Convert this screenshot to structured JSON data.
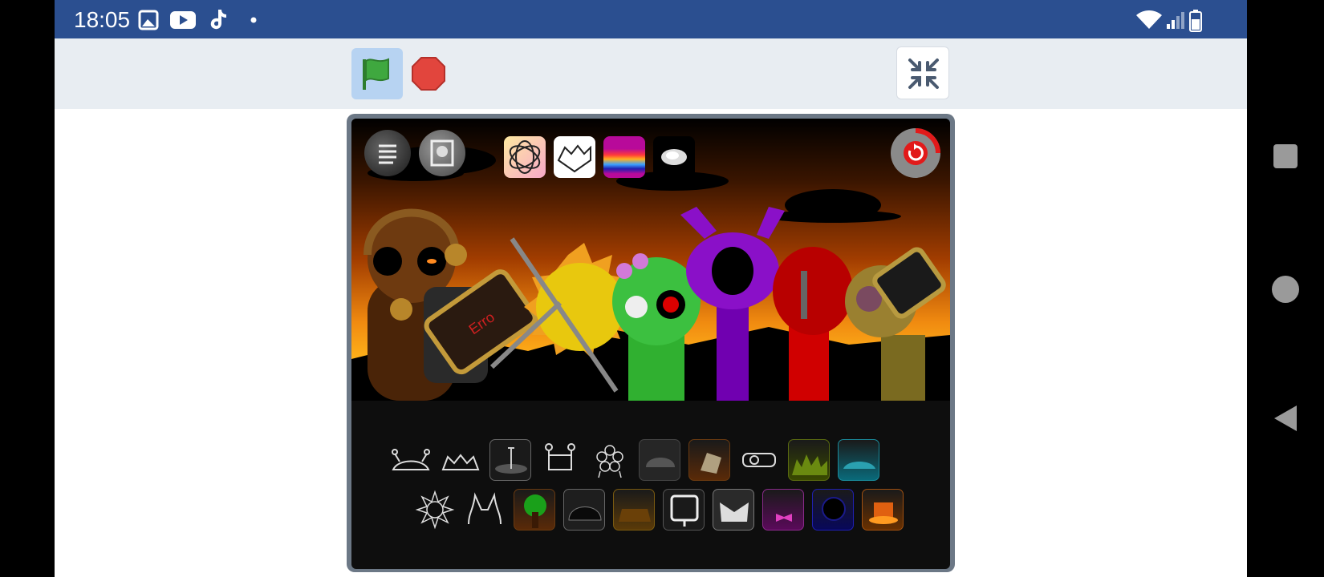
{
  "status": {
    "time": "18:05"
  },
  "colors": {
    "statusbar": "#2b4f90",
    "toolbar": "#e8edf2",
    "flag_green": "#3fa83f",
    "stop_red": "#e2453d"
  },
  "toolbar": {
    "flag_icon": "green-flag-icon",
    "stop_icon": "stop-sign-icon",
    "fullscreen_icon": "exit-fullscreen-icon"
  },
  "stage": {
    "monitor_text": "Erro",
    "top_buttons": [
      "menu",
      "mode-toggle",
      "theme-star",
      "theme-outline",
      "theme-rainbow",
      "theme-orb"
    ],
    "row1_slots": [
      "antenna-crab",
      "horns",
      "pole-dish",
      "robot-head",
      "flower-bunch",
      "dark-helmet",
      "brown-cap",
      "goggles",
      "green-grass",
      "teal-hat"
    ],
    "row2_slots": [
      "spiky-ball",
      "cat-ears",
      "green-tree",
      "dark-blob",
      "orange-hat",
      "monitor",
      "white-mask",
      "pink-bow",
      "blue-orb",
      "orange-glow"
    ]
  }
}
